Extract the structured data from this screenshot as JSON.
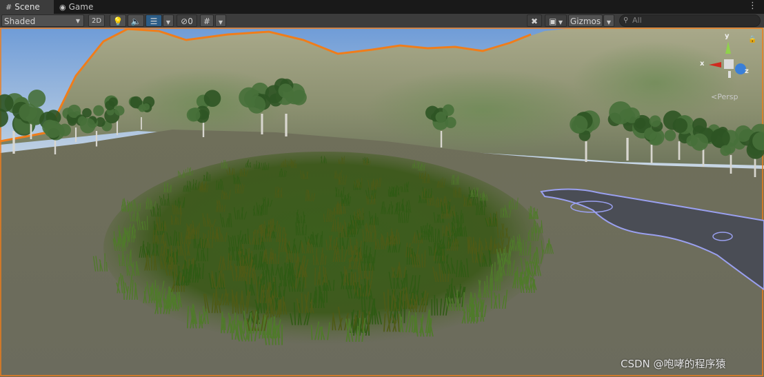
{
  "tabs": [
    {
      "label": "Scene",
      "icon": "grid-icon",
      "active": true
    },
    {
      "label": "Game",
      "icon": "gamepad-icon",
      "active": false
    }
  ],
  "toolbar": {
    "draw_mode": "Shaded",
    "mode_2d": "2D",
    "hidden_count": "0",
    "gizmos": "Gizmos",
    "search_placeholder": "All"
  },
  "viewport": {
    "projection": "Persp",
    "axis_x": "x",
    "axis_y": "y",
    "axis_z": "z",
    "selection_outline_color": "#f07d1a"
  },
  "watermark": "CSDN @咆哮的程序猿"
}
